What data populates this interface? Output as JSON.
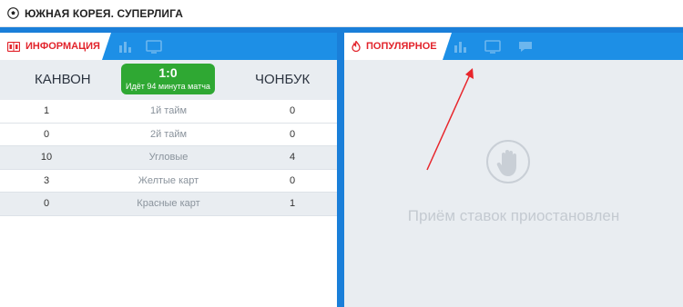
{
  "header": {
    "league_title": "ЮЖНАЯ КОРЕЯ. СУПЕРЛИГА",
    "icon": "soccer-ball-icon"
  },
  "info_panel": {
    "tab_label": "ИНФОРМАЦИЯ",
    "tab_icon": "scoreboard-icon",
    "inactive_tab_icons": [
      "chart-icon",
      "tv-icon"
    ],
    "match": {
      "home_team": "КАНВОН",
      "away_team": "ЧОНБУК",
      "score": "1:0",
      "status": "Идёт 94 минута матча"
    },
    "stats": [
      {
        "home": "1",
        "label": "1й тайм",
        "away": "0"
      },
      {
        "home": "0",
        "label": "2й тайм",
        "away": "0"
      },
      {
        "home": "10",
        "label": "Угловые",
        "away": "4"
      },
      {
        "home": "3",
        "label": "Желтые карт",
        "away": "0"
      },
      {
        "home": "0",
        "label": "Красные карт",
        "away": "1"
      }
    ]
  },
  "popular_panel": {
    "tab_label": "ПОПУЛЯРНОЕ",
    "tab_icon": "fire-icon",
    "inactive_tab_icons": [
      "stats-icon",
      "tv-icon",
      "comment-icon"
    ],
    "suspended_message": "Приём ставок приостановлен",
    "suspended_icon": "stop-hand-icon"
  },
  "colors": {
    "brand_blue": "#1a7fd9",
    "accent_red": "#e2232b",
    "score_green": "#2fa833"
  }
}
